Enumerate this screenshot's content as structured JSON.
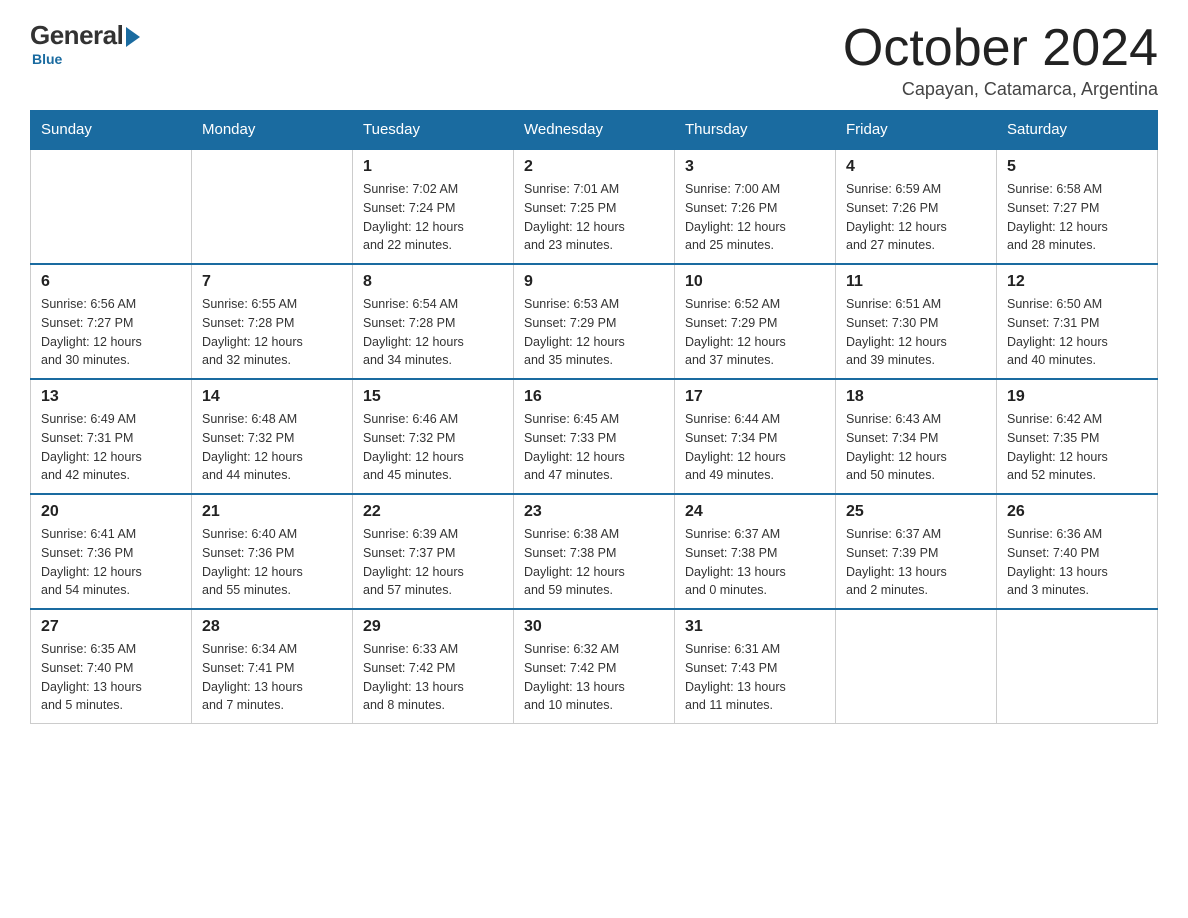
{
  "logo": {
    "general": "General",
    "blue": "Blue",
    "subtitle": "Blue"
  },
  "title": "October 2024",
  "location": "Capayan, Catamarca, Argentina",
  "days_of_week": [
    "Sunday",
    "Monday",
    "Tuesday",
    "Wednesday",
    "Thursday",
    "Friday",
    "Saturday"
  ],
  "weeks": [
    [
      {
        "day": "",
        "info": ""
      },
      {
        "day": "",
        "info": ""
      },
      {
        "day": "1",
        "info": "Sunrise: 7:02 AM\nSunset: 7:24 PM\nDaylight: 12 hours\nand 22 minutes."
      },
      {
        "day": "2",
        "info": "Sunrise: 7:01 AM\nSunset: 7:25 PM\nDaylight: 12 hours\nand 23 minutes."
      },
      {
        "day": "3",
        "info": "Sunrise: 7:00 AM\nSunset: 7:26 PM\nDaylight: 12 hours\nand 25 minutes."
      },
      {
        "day": "4",
        "info": "Sunrise: 6:59 AM\nSunset: 7:26 PM\nDaylight: 12 hours\nand 27 minutes."
      },
      {
        "day": "5",
        "info": "Sunrise: 6:58 AM\nSunset: 7:27 PM\nDaylight: 12 hours\nand 28 minutes."
      }
    ],
    [
      {
        "day": "6",
        "info": "Sunrise: 6:56 AM\nSunset: 7:27 PM\nDaylight: 12 hours\nand 30 minutes."
      },
      {
        "day": "7",
        "info": "Sunrise: 6:55 AM\nSunset: 7:28 PM\nDaylight: 12 hours\nand 32 minutes."
      },
      {
        "day": "8",
        "info": "Sunrise: 6:54 AM\nSunset: 7:28 PM\nDaylight: 12 hours\nand 34 minutes."
      },
      {
        "day": "9",
        "info": "Sunrise: 6:53 AM\nSunset: 7:29 PM\nDaylight: 12 hours\nand 35 minutes."
      },
      {
        "day": "10",
        "info": "Sunrise: 6:52 AM\nSunset: 7:29 PM\nDaylight: 12 hours\nand 37 minutes."
      },
      {
        "day": "11",
        "info": "Sunrise: 6:51 AM\nSunset: 7:30 PM\nDaylight: 12 hours\nand 39 minutes."
      },
      {
        "day": "12",
        "info": "Sunrise: 6:50 AM\nSunset: 7:31 PM\nDaylight: 12 hours\nand 40 minutes."
      }
    ],
    [
      {
        "day": "13",
        "info": "Sunrise: 6:49 AM\nSunset: 7:31 PM\nDaylight: 12 hours\nand 42 minutes."
      },
      {
        "day": "14",
        "info": "Sunrise: 6:48 AM\nSunset: 7:32 PM\nDaylight: 12 hours\nand 44 minutes."
      },
      {
        "day": "15",
        "info": "Sunrise: 6:46 AM\nSunset: 7:32 PM\nDaylight: 12 hours\nand 45 minutes."
      },
      {
        "day": "16",
        "info": "Sunrise: 6:45 AM\nSunset: 7:33 PM\nDaylight: 12 hours\nand 47 minutes."
      },
      {
        "day": "17",
        "info": "Sunrise: 6:44 AM\nSunset: 7:34 PM\nDaylight: 12 hours\nand 49 minutes."
      },
      {
        "day": "18",
        "info": "Sunrise: 6:43 AM\nSunset: 7:34 PM\nDaylight: 12 hours\nand 50 minutes."
      },
      {
        "day": "19",
        "info": "Sunrise: 6:42 AM\nSunset: 7:35 PM\nDaylight: 12 hours\nand 52 minutes."
      }
    ],
    [
      {
        "day": "20",
        "info": "Sunrise: 6:41 AM\nSunset: 7:36 PM\nDaylight: 12 hours\nand 54 minutes."
      },
      {
        "day": "21",
        "info": "Sunrise: 6:40 AM\nSunset: 7:36 PM\nDaylight: 12 hours\nand 55 minutes."
      },
      {
        "day": "22",
        "info": "Sunrise: 6:39 AM\nSunset: 7:37 PM\nDaylight: 12 hours\nand 57 minutes."
      },
      {
        "day": "23",
        "info": "Sunrise: 6:38 AM\nSunset: 7:38 PM\nDaylight: 12 hours\nand 59 minutes."
      },
      {
        "day": "24",
        "info": "Sunrise: 6:37 AM\nSunset: 7:38 PM\nDaylight: 13 hours\nand 0 minutes."
      },
      {
        "day": "25",
        "info": "Sunrise: 6:37 AM\nSunset: 7:39 PM\nDaylight: 13 hours\nand 2 minutes."
      },
      {
        "day": "26",
        "info": "Sunrise: 6:36 AM\nSunset: 7:40 PM\nDaylight: 13 hours\nand 3 minutes."
      }
    ],
    [
      {
        "day": "27",
        "info": "Sunrise: 6:35 AM\nSunset: 7:40 PM\nDaylight: 13 hours\nand 5 minutes."
      },
      {
        "day": "28",
        "info": "Sunrise: 6:34 AM\nSunset: 7:41 PM\nDaylight: 13 hours\nand 7 minutes."
      },
      {
        "day": "29",
        "info": "Sunrise: 6:33 AM\nSunset: 7:42 PM\nDaylight: 13 hours\nand 8 minutes."
      },
      {
        "day": "30",
        "info": "Sunrise: 6:32 AM\nSunset: 7:42 PM\nDaylight: 13 hours\nand 10 minutes."
      },
      {
        "day": "31",
        "info": "Sunrise: 6:31 AM\nSunset: 7:43 PM\nDaylight: 13 hours\nand 11 minutes."
      },
      {
        "day": "",
        "info": ""
      },
      {
        "day": "",
        "info": ""
      }
    ]
  ]
}
